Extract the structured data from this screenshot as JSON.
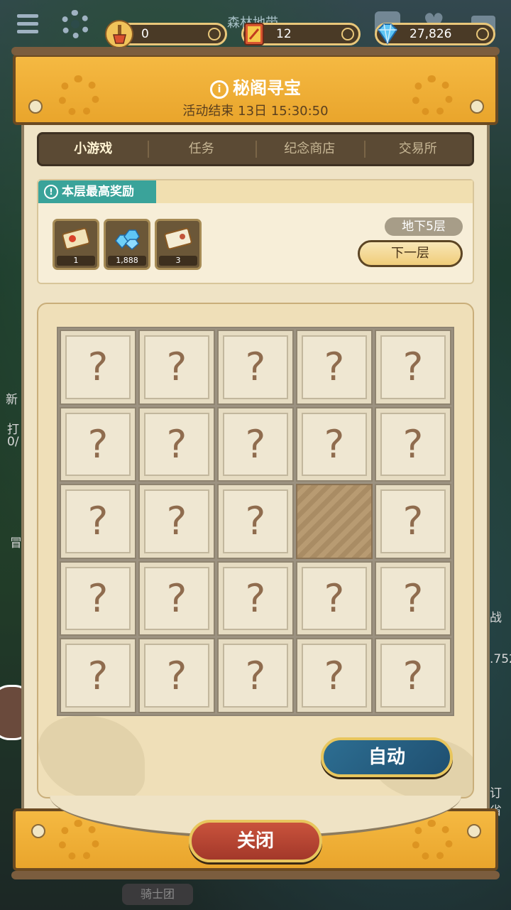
{
  "background": {
    "map_title": "森林地带",
    "side_labels": [
      "新",
      "打",
      "0/",
      "冒",
      "战",
      ".752",
      "订省"
    ],
    "bottom_tab": "骑士团"
  },
  "resources": [
    {
      "name": "shovel",
      "value": "0"
    },
    {
      "name": "scroll",
      "value": "12"
    },
    {
      "name": "gem",
      "value": "27,826"
    }
  ],
  "dialog": {
    "title": "秘阁寻宝",
    "subtitle": "活动结束 13日 15:30:50",
    "tabs": [
      "小游戏",
      "任务",
      "纪念商店",
      "交易所"
    ],
    "active_tab": "小游戏",
    "reward": {
      "title": "本层最高奖励",
      "items": [
        {
          "icon": "ticket-red-icon",
          "count": "1"
        },
        {
          "icon": "diamond-pile-icon",
          "count": "1,888"
        },
        {
          "icon": "ticket-white-icon",
          "count": "3"
        }
      ],
      "floor": "地下5层",
      "next_button": "下一层"
    },
    "grid": {
      "symbol": "?",
      "rows": [
        [
          "?",
          "?",
          "?",
          "?",
          "?"
        ],
        [
          "?",
          "?",
          "?",
          "?",
          "?"
        ],
        [
          "?",
          "?",
          "?",
          "",
          "?"
        ],
        [
          "?",
          "?",
          "?",
          "?",
          "?"
        ],
        [
          "?",
          "?",
          "?",
          "?",
          "?"
        ]
      ],
      "dug": [
        [
          2,
          3
        ]
      ]
    },
    "auto_button": "自动",
    "close_button": "关闭"
  },
  "colors": {
    "header": "#f5b942",
    "panel": "#efe3c5",
    "tab_bar": "#5b4a34",
    "reward_label": "#3aa39a",
    "auto_button": "#2d6e92",
    "close_button": "#c9533c"
  }
}
